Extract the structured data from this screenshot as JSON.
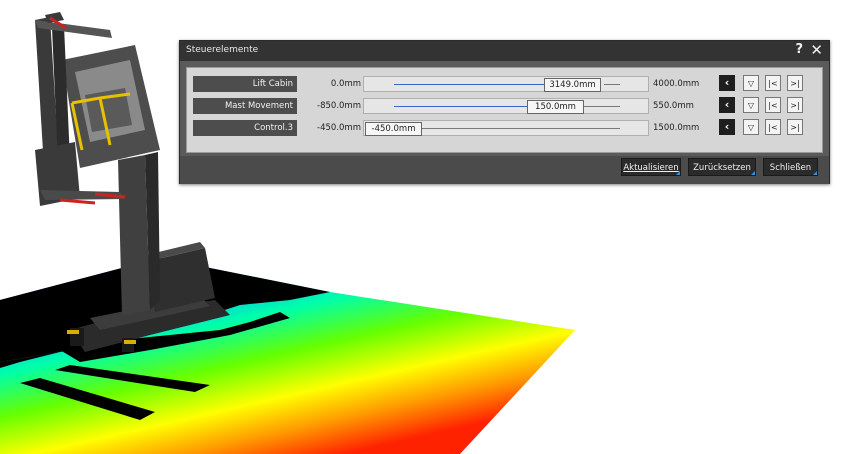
{
  "dialog": {
    "title": "Steuerelemente",
    "help_label": "?",
    "close_label": "✕"
  },
  "controls": [
    {
      "label": "Lift Cabin",
      "min": "0.0mm",
      "value": "3149.0mm",
      "max": "4000.0mm",
      "fraction": 0.787
    },
    {
      "label": "Mast Movement",
      "min": "-850.0mm",
      "value": "150.0mm",
      "max": "550.0mm",
      "fraction": 0.714
    },
    {
      "label": "Control.3",
      "min": "-450.0mm",
      "value": "-450.0mm",
      "max": "1500.0mm",
      "fraction": 0.0
    }
  ],
  "row_buttons": {
    "back_icon": "chevron-left-icon",
    "reset_icon": "triangle-down-icon",
    "to_min_icon": "skip-to-min-icon",
    "to_max_icon": "skip-to-max-icon"
  },
  "footer": {
    "update_label": "Aktualisieren",
    "reset_label": "Zurücksetzen",
    "close_label": "Schließen"
  },
  "colors": {
    "accent": "#2e8fe6",
    "slider_fill": "#3a66c9",
    "titlebar": "#333333",
    "dialog_body": "#5a5a5a"
  }
}
